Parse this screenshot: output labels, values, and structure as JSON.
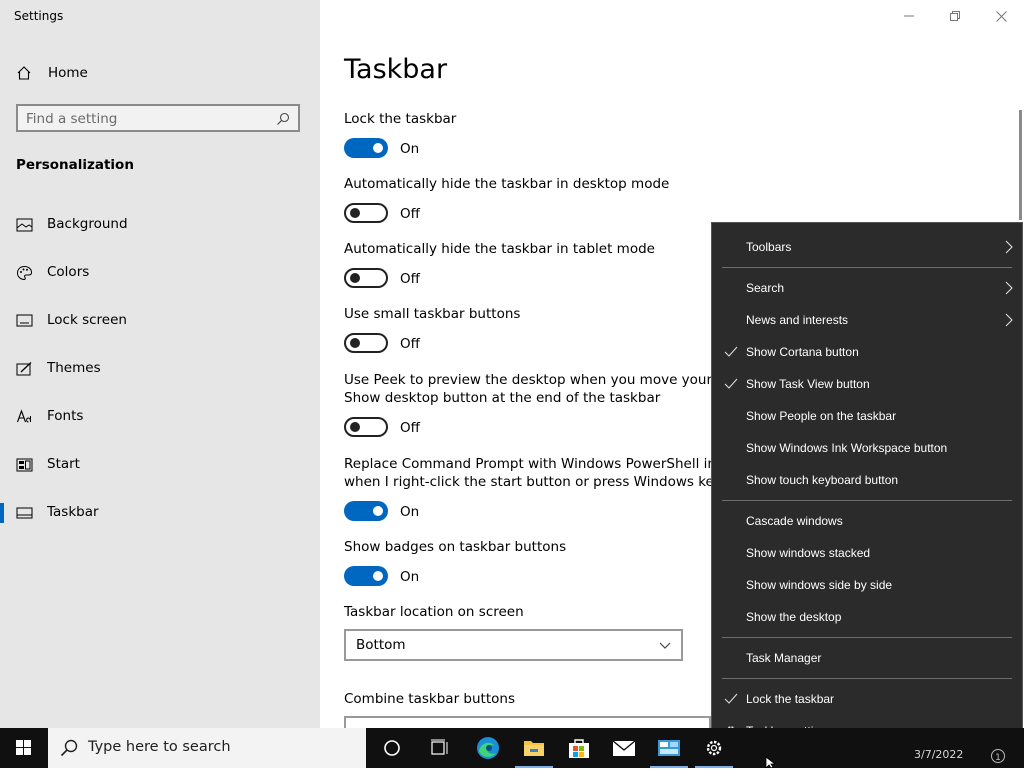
{
  "window": {
    "title": "Settings"
  },
  "sidebar": {
    "home_label": "Home",
    "search_placeholder": "Find a setting",
    "section": "Personalization",
    "items": [
      {
        "label": "Background",
        "icon": "image-icon"
      },
      {
        "label": "Colors",
        "icon": "palette-icon"
      },
      {
        "label": "Lock screen",
        "icon": "lock-screen-icon"
      },
      {
        "label": "Themes",
        "icon": "themes-icon"
      },
      {
        "label": "Fonts",
        "icon": "font-icon"
      },
      {
        "label": "Start",
        "icon": "start-icon"
      },
      {
        "label": "Taskbar",
        "icon": "taskbar-icon"
      }
    ]
  },
  "main": {
    "title": "Taskbar",
    "settings": [
      {
        "label": "Lock the taskbar",
        "state": "On"
      },
      {
        "label": "Automatically hide the taskbar in desktop mode",
        "state": "Off"
      },
      {
        "label": "Automatically hide the taskbar in tablet mode",
        "state": "Off"
      },
      {
        "label": "Use small taskbar buttons",
        "state": "Off"
      },
      {
        "label_line1": "Use Peek to preview the desktop when you move your mou",
        "label_line2": "Show desktop button at the end of the taskbar",
        "state": "Off"
      },
      {
        "label_line1": "Replace Command Prompt with Windows PowerShell in the",
        "label_line2": "when I right-click the start button or press Windows key+X",
        "state": "On"
      },
      {
        "label": "Show badges on taskbar buttons",
        "state": "On"
      }
    ],
    "location_label": "Taskbar location on screen",
    "location_value": "Bottom",
    "combine_label": "Combine taskbar buttons"
  },
  "context_menu": {
    "toolbars": "Toolbars",
    "search": "Search",
    "news": "News and interests",
    "show_cortana": "Show Cortana button",
    "show_task_view": "Show Task View button",
    "show_people": "Show People on the taskbar",
    "show_ink": "Show Windows Ink Workspace button",
    "show_touch_keyboard": "Show touch keyboard button",
    "cascade": "Cascade windows",
    "stacked": "Show windows stacked",
    "side_by_side": "Show windows side by side",
    "show_desktop": "Show the desktop",
    "task_manager": "Task Manager",
    "lock_taskbar": "Lock the taskbar",
    "taskbar_settings": "Taskbar settings"
  },
  "taskbar": {
    "search_placeholder": "Type here to search",
    "date": "3/7/2022"
  },
  "colors": {
    "accent": "#0067c0",
    "sidebar_bg": "#e6e6e6",
    "menu_bg": "#2b2b2b",
    "taskbar_bg": "#101010"
  }
}
